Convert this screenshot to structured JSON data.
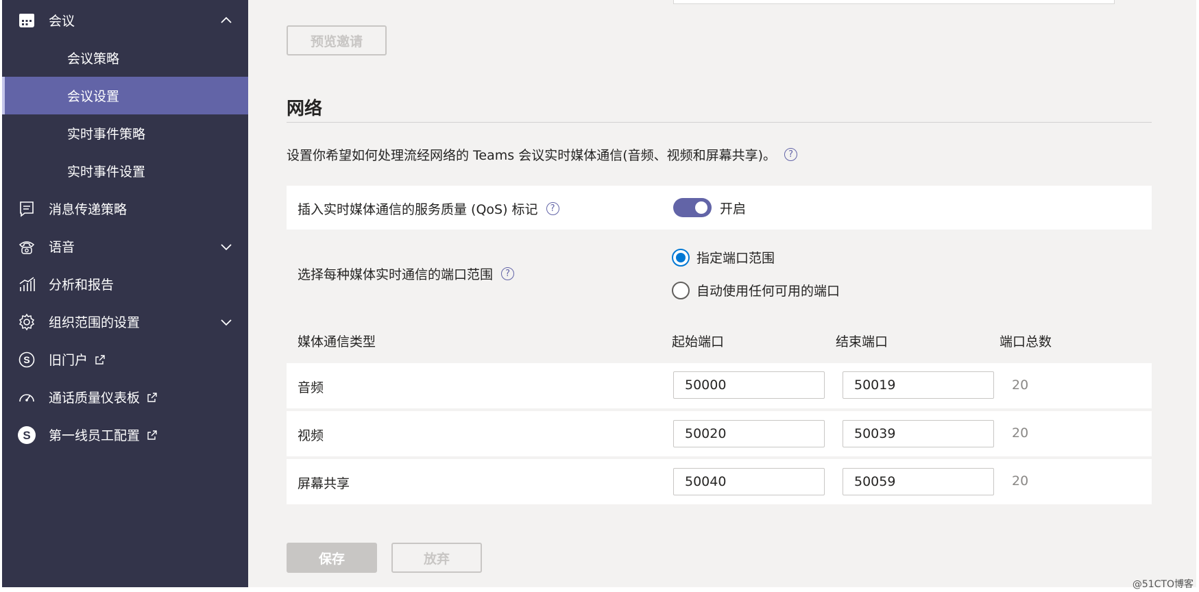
{
  "sidebar": {
    "items": [
      {
        "label": "会议",
        "icon": "calendar-icon",
        "chevron": "chevron-up-icon"
      },
      {
        "label": "会议策略"
      },
      {
        "label": "会议设置",
        "active": true
      },
      {
        "label": "实时事件策略"
      },
      {
        "label": "实时事件设置"
      },
      {
        "label": "消息传递策略",
        "icon": "message-icon"
      },
      {
        "label": "语音",
        "icon": "phone-icon",
        "chevron": "chevron-down-icon"
      },
      {
        "label": "分析和报告",
        "icon": "analytics-icon"
      },
      {
        "label": "组织范围的设置",
        "icon": "gear-icon",
        "chevron": "chevron-down-icon"
      },
      {
        "label": "旧门户",
        "icon": "skype-icon",
        "external": true
      },
      {
        "label": "通话质量仪表板",
        "icon": "gauge-icon",
        "external": true
      },
      {
        "label": "第一线员工配置",
        "icon": "s-logo-icon",
        "external": true
      }
    ]
  },
  "main": {
    "preview_button": "预览邀请",
    "section_title": "网络",
    "description": "设置你希望如何处理流经网络的 Teams 会议实时媒体通信(音频、视频和屏幕共享)。",
    "qos": {
      "label": "插入实时媒体通信的服务质量 (QoS) 标记",
      "toggle_state": "开启",
      "toggle_on": true
    },
    "port_range": {
      "label": "选择每种媒体实时通信的端口范围",
      "options": [
        "指定端口范围",
        "自动使用任何可用的端口"
      ],
      "selected": 0
    },
    "table": {
      "headers": [
        "媒体通信类型",
        "起始端口",
        "结束端口",
        "端口总数"
      ],
      "rows": [
        {
          "type": "音频",
          "start": "50000",
          "end": "50019",
          "total": "20"
        },
        {
          "type": "视频",
          "start": "50020",
          "end": "50039",
          "total": "20"
        },
        {
          "type": "屏幕共享",
          "start": "50040",
          "end": "50059",
          "total": "20"
        }
      ]
    },
    "save_button": "保存",
    "discard_button": "放弃"
  },
  "watermark": "@51CTO博客",
  "colors": {
    "sidebar_bg": "#33344a",
    "accent": "#6264a7",
    "radio_blue": "#0078d4",
    "main_bg": "#f3f2f1"
  }
}
